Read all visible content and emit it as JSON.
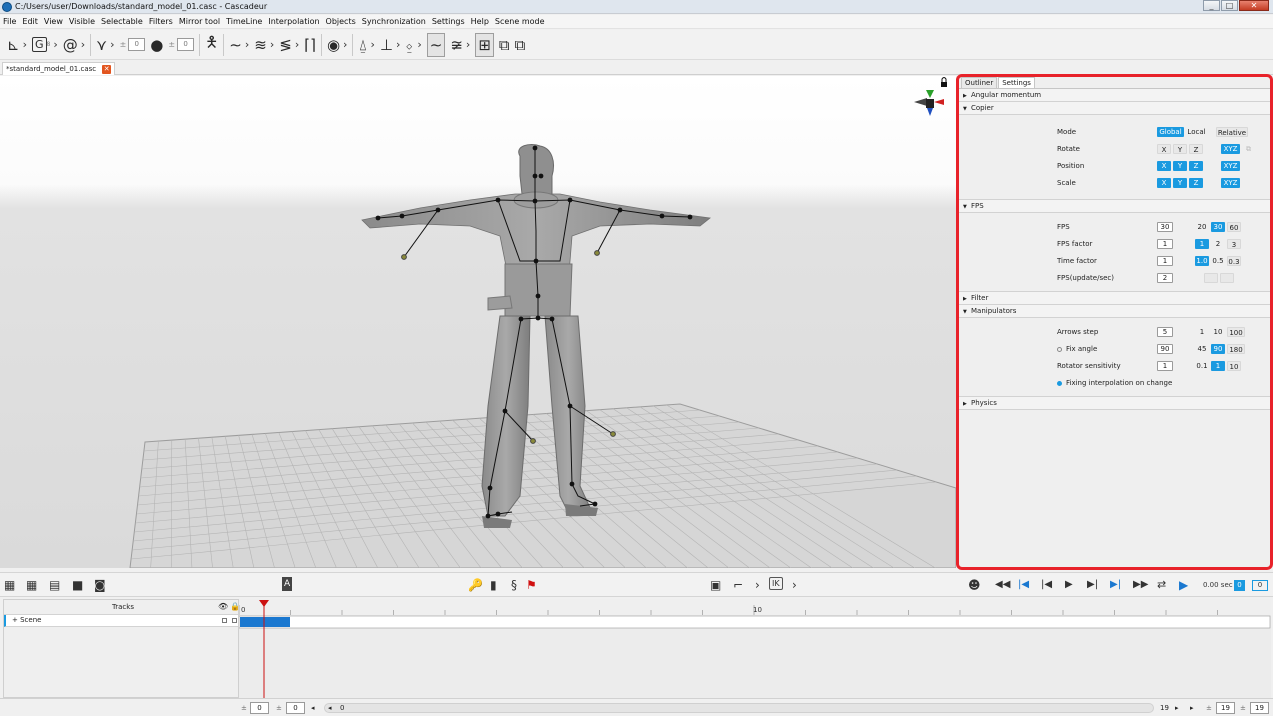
{
  "window": {
    "title": "C:/Users/user/Downloads/standard_model_01.casc - Cascadeur",
    "minimize": "_",
    "maximize": "□",
    "close": "✕"
  },
  "menu": [
    "File",
    "Edit",
    "View",
    "Visible",
    "Selectable",
    "Filters",
    "Mirror tool",
    "TimeLine",
    "Interpolation",
    "Objects",
    "Synchronization",
    "Settings",
    "Help",
    "Scene mode"
  ],
  "toolbar": {
    "field1": "0",
    "field2": "0",
    "g_label": "G",
    "g_badge": "8"
  },
  "document_tab": {
    "label": "*standard_model_01.casc",
    "close": "✕"
  },
  "panel": {
    "tabs": [
      "Outliner",
      "Settings"
    ],
    "sections": {
      "angular_momentum": "Angular momentum",
      "copier": "Copier",
      "fps": "FPS",
      "filter": "Filter",
      "manipulators": "Manipulators",
      "physics": "Physics"
    },
    "copier": {
      "mode_label": "Mode",
      "mode_options": [
        "Global",
        "Local",
        "Relative"
      ],
      "rotate_label": "Rotate",
      "position_label": "Position",
      "scale_label": "Scale",
      "axes": [
        "X",
        "Y",
        "Z"
      ],
      "xyz": "XYZ"
    },
    "fps": {
      "fps_label": "FPS",
      "fps_value": "30",
      "fps_options": [
        "20",
        "30",
        "60"
      ],
      "factor_label": "FPS factor",
      "factor_value": "1",
      "factor_options": [
        "1",
        "2",
        "3"
      ],
      "time_label": "Time factor",
      "time_value": "1",
      "time_options": [
        "1.0",
        "0.5",
        "0.3"
      ],
      "update_label": "FPS(update/sec)",
      "update_value": "2"
    },
    "manipulators": {
      "arrows_label": "Arrows step",
      "arrows_value": "5",
      "arrows_options": [
        "1",
        "10",
        "100"
      ],
      "fix_label": "Fix angle",
      "fix_value": "90",
      "fix_options": [
        "45",
        "90",
        "180"
      ],
      "rot_label": "Rotator sensitivity",
      "rot_value": "1",
      "rot_options": [
        "0.1",
        "1",
        "10"
      ],
      "interp_label": "Fixing interpolation on change"
    }
  },
  "playback": {
    "time": "0.00 sec",
    "frame": "0",
    "frame2": "0"
  },
  "tracks": {
    "header": "Tracks",
    "scene_label": "+ Scene"
  },
  "timeline": {
    "ruler": [
      "0",
      "10"
    ]
  },
  "bottom": {
    "start": "0",
    "left_val": "0",
    "cur": "0",
    "end_label": "19",
    "end1": "19",
    "end2": "19"
  },
  "colors": {
    "accent": "#1a9ae0",
    "highlight_border": "#e8222a",
    "keyframe": "#1a78d0",
    "playhead": "#cc1111"
  }
}
